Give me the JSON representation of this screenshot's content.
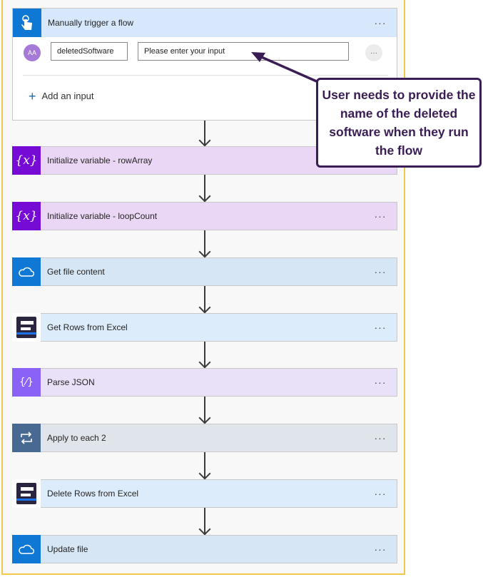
{
  "trigger": {
    "title": "Manually trigger a flow",
    "input_name": "deletedSoftware",
    "input_placeholder": "Please enter your input",
    "avatar_text": "AA",
    "add_input_label": "Add an input",
    "more_label": "···"
  },
  "steps": [
    {
      "label": "Initialize variable - rowArray",
      "icon": "variable-icon"
    },
    {
      "label": "Initialize variable - loopCount",
      "icon": "variable-icon"
    },
    {
      "label": "Get file content",
      "icon": "onedrive-icon"
    },
    {
      "label": "Get Rows from Excel",
      "icon": "excel-rows-icon"
    },
    {
      "label": "Parse JSON",
      "icon": "parse-json-icon"
    },
    {
      "label": "Apply to each 2",
      "icon": "loop-icon"
    },
    {
      "label": "Delete Rows from Excel",
      "icon": "excel-rows-icon"
    },
    {
      "label": "Update file",
      "icon": "onedrive-icon"
    }
  ],
  "more_label": "···",
  "callout": {
    "text": "User needs to provide the name of the deleted software when they run the flow"
  },
  "colors": {
    "trigger_bg": "#d8e8fc",
    "variable_bg": "#ead7f5",
    "variable_icon": "#770bd6",
    "onedrive_bg": "#d6e6f5",
    "onedrive_icon": "#0f78d4",
    "excel_bg": "#dcecfb",
    "parse_bg": "#e8e1f7",
    "parse_icon": "#8a62f5",
    "loop_bg": "#e0e5ec",
    "loop_icon": "#486991",
    "callout_border": "#3a1d55",
    "frame_border": "#f2c84a"
  }
}
